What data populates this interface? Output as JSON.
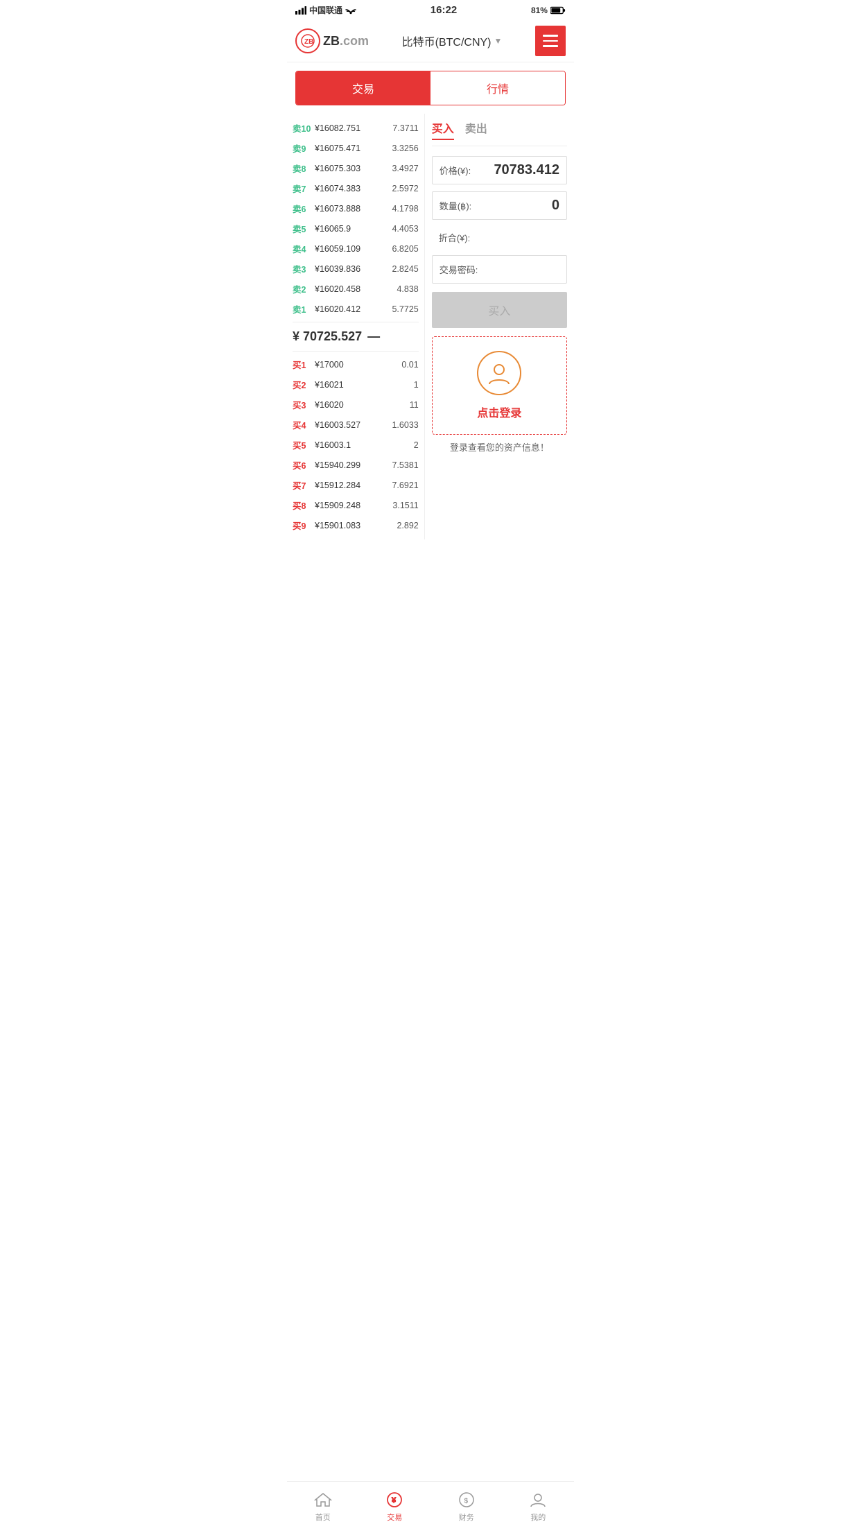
{
  "statusBar": {
    "carrier": "中国联通",
    "time": "16:22",
    "battery": "81%"
  },
  "header": {
    "logoText": "ZB",
    "logoDomain": ".com",
    "title": "比特币(BTC/CNY)",
    "menuLabel": "menu"
  },
  "tabs": {
    "items": [
      {
        "label": "交易",
        "active": true
      },
      {
        "label": "行情",
        "active": false
      }
    ]
  },
  "buySellTabs": {
    "buy": "买入",
    "sell": "卖出"
  },
  "sellOrders": [
    {
      "label": "卖10",
      "price": "¥16082.751",
      "qty": "7.3711"
    },
    {
      "label": "卖9",
      "price": "¥16075.471",
      "qty": "3.3256"
    },
    {
      "label": "卖8",
      "price": "¥16075.303",
      "qty": "3.4927"
    },
    {
      "label": "卖7",
      "price": "¥16074.383",
      "qty": "2.5972"
    },
    {
      "label": "卖6",
      "price": "¥16073.888",
      "qty": "4.1798"
    },
    {
      "label": "卖5",
      "price": "¥16065.9",
      "qty": "4.4053"
    },
    {
      "label": "卖4",
      "price": "¥16059.109",
      "qty": "6.8205"
    },
    {
      "label": "卖3",
      "price": "¥16039.836",
      "qty": "2.8245"
    },
    {
      "label": "卖2",
      "price": "¥16020.458",
      "qty": "4.838"
    },
    {
      "label": "卖1",
      "price": "¥16020.412",
      "qty": "5.7725"
    }
  ],
  "currentPrice": "¥ 70725.527",
  "priceIndicator": "—",
  "buyOrders": [
    {
      "label": "买1",
      "price": "¥17000",
      "qty": "0.01"
    },
    {
      "label": "买2",
      "price": "¥16021",
      "qty": "1"
    },
    {
      "label": "买3",
      "price": "¥16020",
      "qty": "11"
    },
    {
      "label": "买4",
      "price": "¥16003.527",
      "qty": "1.6033"
    },
    {
      "label": "买5",
      "price": "¥16003.1",
      "qty": "2"
    },
    {
      "label": "买6",
      "price": "¥15940.299",
      "qty": "7.5381"
    },
    {
      "label": "买7",
      "price": "¥15912.284",
      "qty": "7.6921"
    },
    {
      "label": "买8",
      "price": "¥15909.248",
      "qty": "3.1511"
    },
    {
      "label": "买9",
      "price": "¥15901.083",
      "qty": "2.892"
    }
  ],
  "form": {
    "priceLabel": "价格(¥):",
    "priceValue": "70783.412",
    "qtyLabel": "数量(฿):",
    "qtyValue": "0",
    "totalLabel": "折合(¥):",
    "totalValue": "",
    "passwordLabel": "交易密码:",
    "passwordValue": "",
    "buyBtnLabel": "买入"
  },
  "loginPrompt": {
    "text": "点击登录",
    "subText": "登录查看您的资产信息！"
  },
  "bottomNav": [
    {
      "label": "首页",
      "icon": "home",
      "active": false
    },
    {
      "label": "交易",
      "icon": "trade",
      "active": true
    },
    {
      "label": "财务",
      "icon": "finance",
      "active": false
    },
    {
      "label": "我的",
      "icon": "profile",
      "active": false
    }
  ]
}
